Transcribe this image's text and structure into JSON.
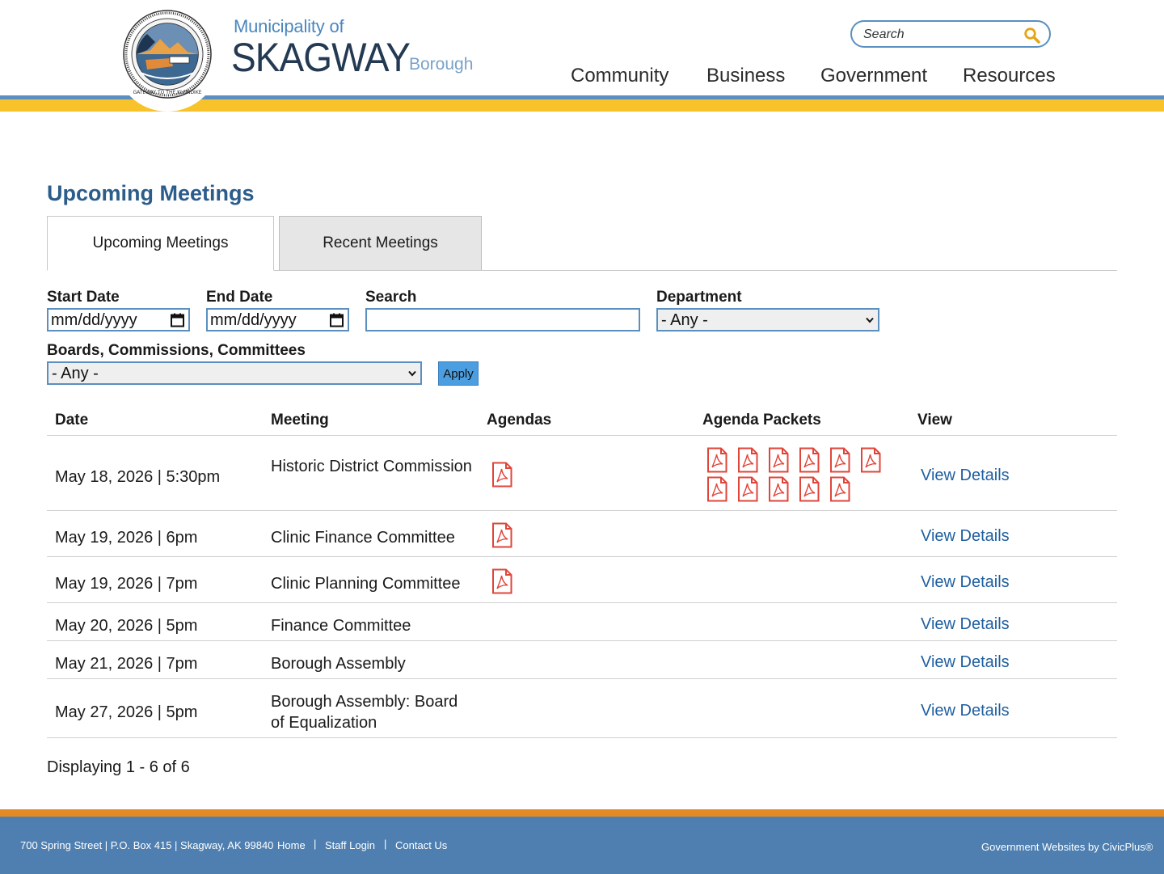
{
  "header": {
    "logo_line1": "Municipality of",
    "logo_main": "SKAGWAY",
    "logo_suffix": "Borough",
    "search_placeholder": "Search",
    "nav": [
      "Community",
      "Business",
      "Government",
      "Resources"
    ]
  },
  "page": {
    "title": "Upcoming Meetings",
    "tabs": [
      {
        "label": "Upcoming Meetings",
        "active": true
      },
      {
        "label": "Recent Meetings",
        "active": false
      }
    ]
  },
  "filters": {
    "start_date_label": "Start Date",
    "start_date_value": "mm/dd/yyyy",
    "end_date_label": "End Date",
    "end_date_value": "mm/dd/yyyy",
    "search_label": "Search",
    "department_label": "Department",
    "department_value": "- Any -",
    "boards_label": "Boards, Commissions, Committees",
    "boards_value": "- Any -",
    "apply_label": "Apply"
  },
  "table": {
    "headers": [
      "Date",
      "Meeting",
      "Agendas",
      "Agenda Packets",
      "View"
    ],
    "rows": [
      {
        "date": "May 18, 2026 | 5:30pm",
        "meeting": "Historic District Commission",
        "agendas": 1,
        "packets": 11,
        "view": "View Details"
      },
      {
        "date": "May 19, 2026 | 6pm",
        "meeting": "Clinic Finance Committee",
        "agendas": 1,
        "packets": 0,
        "view": "View Details"
      },
      {
        "date": "May 19, 2026 | 7pm",
        "meeting": "Clinic Planning Committee",
        "agendas": 1,
        "packets": 0,
        "view": "View Details"
      },
      {
        "date": "May 20, 2026 | 5pm",
        "meeting": "Finance Committee",
        "agendas": 0,
        "packets": 0,
        "view": "View Details"
      },
      {
        "date": "May 21, 2026 | 7pm",
        "meeting": "Borough Assembly",
        "agendas": 0,
        "packets": 0,
        "view": "View Details"
      },
      {
        "date": "May 27, 2026 | 5pm",
        "meeting": "Borough Assembly: Board of Equalization",
        "agendas": 0,
        "packets": 0,
        "view": "View Details"
      }
    ],
    "displaying": "Displaying 1 - 6 of 6"
  },
  "footer": {
    "address": "700 Spring Street | P.O. Box 415 | Skagway, AK 99840",
    "links": [
      "Home",
      "Staff Login",
      "Contact Us"
    ],
    "credit": "Government Websites by CivicPlus®"
  },
  "colors": {
    "accent_blue": "#5a8fc0",
    "accent_yellow": "#f8c22a",
    "footer_blue": "#4e7fb0",
    "footer_orange": "#e58a22",
    "title_blue": "#2b5c8a",
    "link_blue": "#1f5fa0",
    "pdf_red": "#e0453a"
  }
}
